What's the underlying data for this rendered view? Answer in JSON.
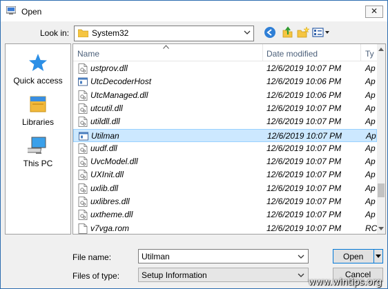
{
  "window": {
    "title": "Open",
    "close_glyph": "✕"
  },
  "lookin": {
    "label": "Look in:",
    "value": "System32"
  },
  "places": [
    {
      "label": "Quick access",
      "icon": "star-icon"
    },
    {
      "label": "Libraries",
      "icon": "libraries-icon"
    },
    {
      "label": "This PC",
      "icon": "computer-icon"
    }
  ],
  "columns": {
    "name": "Name",
    "date": "Date modified",
    "type": "Ty"
  },
  "files": [
    {
      "name": "ustprov.dll",
      "date": "12/6/2019 10:07 PM",
      "type": "Ap",
      "icon": "dll-icon"
    },
    {
      "name": "UtcDecoderHost",
      "date": "12/6/2019 10:06 PM",
      "type": "Ap",
      "icon": "exe-icon"
    },
    {
      "name": "UtcManaged.dll",
      "date": "12/6/2019 10:06 PM",
      "type": "Ap",
      "icon": "dll-icon"
    },
    {
      "name": "utcutil.dll",
      "date": "12/6/2019 10:07 PM",
      "type": "Ap",
      "icon": "dll-icon"
    },
    {
      "name": "utildll.dll",
      "date": "12/6/2019 10:07 PM",
      "type": "Ap",
      "icon": "dll-icon"
    },
    {
      "name": "Utilman",
      "date": "12/6/2019 10:07 PM",
      "type": "Ap",
      "icon": "exe-icon",
      "selected": true
    },
    {
      "name": "uudf.dll",
      "date": "12/6/2019 10:07 PM",
      "type": "Ap",
      "icon": "dll-icon"
    },
    {
      "name": "UvcModel.dll",
      "date": "12/6/2019 10:07 PM",
      "type": "Ap",
      "icon": "dll-icon"
    },
    {
      "name": "UXInit.dll",
      "date": "12/6/2019 10:07 PM",
      "type": "Ap",
      "icon": "dll-icon"
    },
    {
      "name": "uxlib.dll",
      "date": "12/6/2019 10:07 PM",
      "type": "Ap",
      "icon": "dll-icon"
    },
    {
      "name": "uxlibres.dll",
      "date": "12/6/2019 10:07 PM",
      "type": "Ap",
      "icon": "dll-icon"
    },
    {
      "name": "uxtheme.dll",
      "date": "12/6/2019 10:07 PM",
      "type": "Ap",
      "icon": "dll-icon"
    },
    {
      "name": "v7vga.rom",
      "date": "12/6/2019 10:07 PM",
      "type": "RC",
      "icon": "file-icon"
    }
  ],
  "filename": {
    "label": "File name:",
    "value": "Utilman"
  },
  "filetype": {
    "label": "Files of type:",
    "value": "Setup Information"
  },
  "buttons": {
    "open": "Open",
    "cancel": "Cancel"
  },
  "watermark": "www.wintips.org",
  "colors": {
    "selection": "#cce8ff",
    "accent": "#0078d7"
  }
}
